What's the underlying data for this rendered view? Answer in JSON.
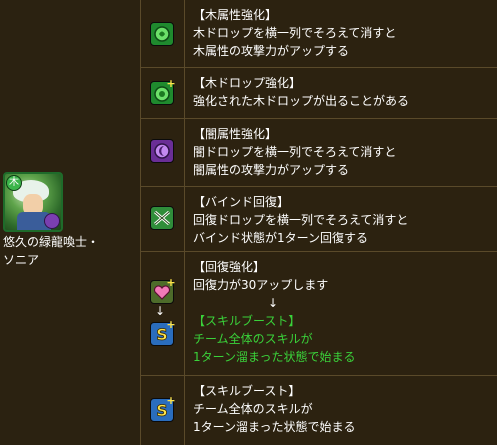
{
  "monster": {
    "name": "悠久の緑龍喚士・ソニア",
    "name_line1": "悠久の緑龍喚士・",
    "name_line2": "ソニア",
    "attribute_badge": "木",
    "main_color": "#3bb54a",
    "sub_color": "#7a3fb0"
  },
  "awakenings": [
    {
      "icon": "wood-row-enhance-icon",
      "lines": [
        "【木属性強化】",
        "木ドロップを横一列でそろえて消すと",
        "木属性の攻撃力がアップする"
      ]
    },
    {
      "icon": "enhanced-wood-orb-icon",
      "lines": [
        "【木ドロップ強化】",
        "強化された木ドロップが出ることがある"
      ]
    },
    {
      "icon": "dark-row-enhance-icon",
      "lines": [
        "【闇属性強化】",
        "闇ドロップを横一列でそろえて消すと",
        "闇属性の攻撃力がアップする"
      ]
    },
    {
      "icon": "bind-recovery-icon",
      "lines": [
        "【バインド回復】",
        "回復ドロップを横一列でそろえて消すと",
        "バインド状態が1ターン回復する"
      ]
    },
    {
      "icon": "recovery-boost-icon",
      "icon2": "skill-boost-icon",
      "arrow_small": "↓",
      "lines": [
        "【回復強化】",
        "回復力が30アップします"
      ],
      "arrow": "↓",
      "green_lines": [
        "【スキルブースト】",
        "チーム全体のスキルが",
        "1ターン溜まった状態で始まる"
      ]
    },
    {
      "icon": "skill-boost-icon",
      "lines": [
        "【スキルブースト】",
        "チーム全体のスキルが",
        "1ターン溜まった状態で始まる"
      ]
    }
  ],
  "colors": {
    "background": "#2c2210",
    "border": "#5a4a2a",
    "text": "#ffffff",
    "highlight_green": "#3ad23a"
  }
}
